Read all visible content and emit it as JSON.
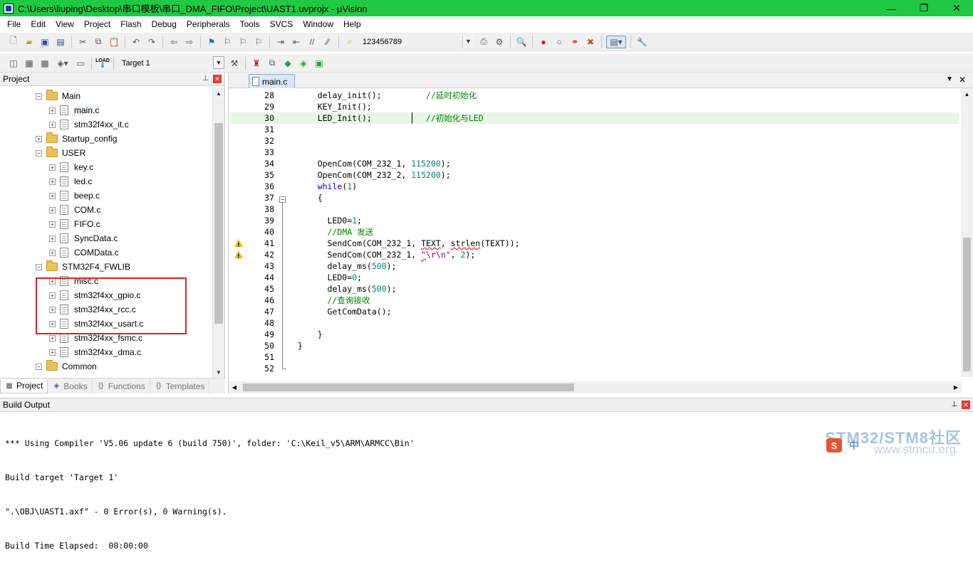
{
  "window": {
    "title": "C:\\Users\\liuping\\Desktop\\串口模板\\串口_DMA_FIFO\\Project\\UAST1.uvprojx - µVision",
    "minimize_glyph": "—",
    "restore_glyph": "❐",
    "close_glyph": "✕"
  },
  "menu": [
    "File",
    "Edit",
    "View",
    "Project",
    "Flash",
    "Debug",
    "Peripherals",
    "Tools",
    "SVCS",
    "Window",
    "Help"
  ],
  "toolbar1": {
    "find_combo_value": "123456789"
  },
  "toolbar2": {
    "target_combo_value": "Target 1",
    "load_label": "LOAD"
  },
  "project_panel": {
    "title": "Project",
    "pin_glyph": "⊥",
    "close_glyph": "✕",
    "tree": [
      {
        "type": "folder",
        "label": "Main",
        "expanded": true
      },
      {
        "type": "file",
        "label": "main.c",
        "selected": true
      },
      {
        "type": "file",
        "label": "stm32f4xx_it.c"
      },
      {
        "type": "folder",
        "label": "Startup_config",
        "expanded": false
      },
      {
        "type": "folder",
        "label": "USER",
        "expanded": true
      },
      {
        "type": "file",
        "label": "key.c"
      },
      {
        "type": "file",
        "label": "led.c"
      },
      {
        "type": "file",
        "label": "beep.c"
      },
      {
        "type": "file",
        "label": "COM.c"
      },
      {
        "type": "file",
        "label": "FIFO.c"
      },
      {
        "type": "file",
        "label": "SyncData.c"
      },
      {
        "type": "file",
        "label": "COMData.c"
      },
      {
        "type": "folder",
        "label": "STM32F4_FWLIB",
        "expanded": true
      },
      {
        "type": "file",
        "label": "misc.c"
      },
      {
        "type": "file",
        "label": "stm32f4xx_gpio.c"
      },
      {
        "type": "file",
        "label": "stm32f4xx_rcc.c"
      },
      {
        "type": "file",
        "label": "stm32f4xx_usart.c"
      },
      {
        "type": "file",
        "label": "stm32f4xx_fsmc.c"
      },
      {
        "type": "file",
        "label": "stm32f4xx_dma.c"
      },
      {
        "type": "folder",
        "label": "Common",
        "expanded": true
      }
    ],
    "tabs": [
      "Project",
      "Books",
      "Functions",
      "Templates"
    ]
  },
  "editor": {
    "active_tab": "main.c",
    "lines": [
      {
        "n": "28",
        "segs": [
          [
            "    delay_init();         ",
            ""
          ],
          [
            "//延时初始化",
            "cm"
          ]
        ]
      },
      {
        "n": "29",
        "segs": [
          [
            "    KEY_Init();",
            ""
          ]
        ]
      },
      {
        "n": "30",
        "segs": [
          [
            "    LED_Init();           ",
            ""
          ],
          [
            "//初始化与LED",
            "cm"
          ]
        ],
        "current": true
      },
      {
        "n": "31",
        "segs": []
      },
      {
        "n": "32",
        "segs": []
      },
      {
        "n": "33",
        "segs": []
      },
      {
        "n": "34",
        "segs": [
          [
            "    OpenCom(COM_232_1, ",
            ""
          ],
          [
            "115200",
            "num"
          ],
          [
            ");",
            ""
          ]
        ]
      },
      {
        "n": "35",
        "segs": [
          [
            "    OpenCom(COM_232_2, ",
            ""
          ],
          [
            "115200",
            "num"
          ],
          [
            ");",
            ""
          ]
        ]
      },
      {
        "n": "36",
        "segs": [
          [
            "    ",
            ""
          ],
          [
            "while",
            "kw"
          ],
          [
            "(",
            ""
          ],
          [
            "1",
            "num"
          ],
          [
            ")",
            ""
          ]
        ]
      },
      {
        "n": "37",
        "segs": [
          [
            "    {",
            ""
          ]
        ]
      },
      {
        "n": "38",
        "segs": []
      },
      {
        "n": "39",
        "segs": [
          [
            "      LED0=",
            ""
          ],
          [
            "1",
            "num"
          ],
          [
            ";",
            ""
          ]
        ]
      },
      {
        "n": "40",
        "segs": [
          [
            "      ",
            ""
          ],
          [
            "//DMA 发送",
            "cm"
          ]
        ]
      },
      {
        "n": "41",
        "segs": [
          [
            "      SendCom(COM_232_1, ",
            ""
          ],
          [
            "TEXT",
            "squig"
          ],
          [
            ", ",
            ""
          ],
          [
            "strlen",
            "squig"
          ],
          [
            "(TEXT));",
            ""
          ]
        ],
        "warning": true
      },
      {
        "n": "42",
        "segs": [
          [
            "      SendCom(COM_232_1, ",
            ""
          ],
          [
            "\"",
            "squig str"
          ],
          [
            "\\r\\n\"",
            "str"
          ],
          [
            ", ",
            ""
          ],
          [
            "2",
            "num"
          ],
          [
            ");",
            ""
          ]
        ],
        "warning": true
      },
      {
        "n": "43",
        "segs": [
          [
            "      delay_ms(",
            ""
          ],
          [
            "500",
            "num"
          ],
          [
            ");",
            ""
          ]
        ]
      },
      {
        "n": "44",
        "segs": [
          [
            "      LED0=",
            ""
          ],
          [
            "0",
            "num"
          ],
          [
            ";",
            ""
          ]
        ]
      },
      {
        "n": "45",
        "segs": [
          [
            "      delay_ms(",
            ""
          ],
          [
            "500",
            "num"
          ],
          [
            ");",
            ""
          ]
        ]
      },
      {
        "n": "46",
        "segs": [
          [
            "      ",
            ""
          ],
          [
            "//查询接收",
            "cm"
          ]
        ]
      },
      {
        "n": "47",
        "segs": [
          [
            "      GetComData();",
            ""
          ]
        ]
      },
      {
        "n": "48",
        "segs": []
      },
      {
        "n": "49",
        "segs": [
          [
            "    }",
            ""
          ]
        ]
      },
      {
        "n": "50",
        "segs": [
          [
            "}",
            ""
          ]
        ]
      },
      {
        "n": "51",
        "segs": []
      },
      {
        "n": "52",
        "segs": []
      }
    ]
  },
  "build_output": {
    "title": "Build Output",
    "lines": [
      "*** Using Compiler 'V5.06 update 6 (build 750)', folder: 'C:\\Keil_v5\\ARM\\ARMCC\\Bin'",
      "Build target 'Target 1'",
      "\".\\OBJ\\UAST1.axf\" - 0 Error(s), 0 Warning(s).",
      "Build Time Elapsed:  00:00:00"
    ]
  },
  "watermark": {
    "main": "STM32/STM8社区",
    "sub": "www.stmcu.org",
    "ime_label": "中"
  },
  "colors": {
    "titlebar": "#1fc944",
    "keyword": "#0000ff",
    "comment": "#008000",
    "number": "#008080",
    "highlight_box": "#e02020"
  }
}
